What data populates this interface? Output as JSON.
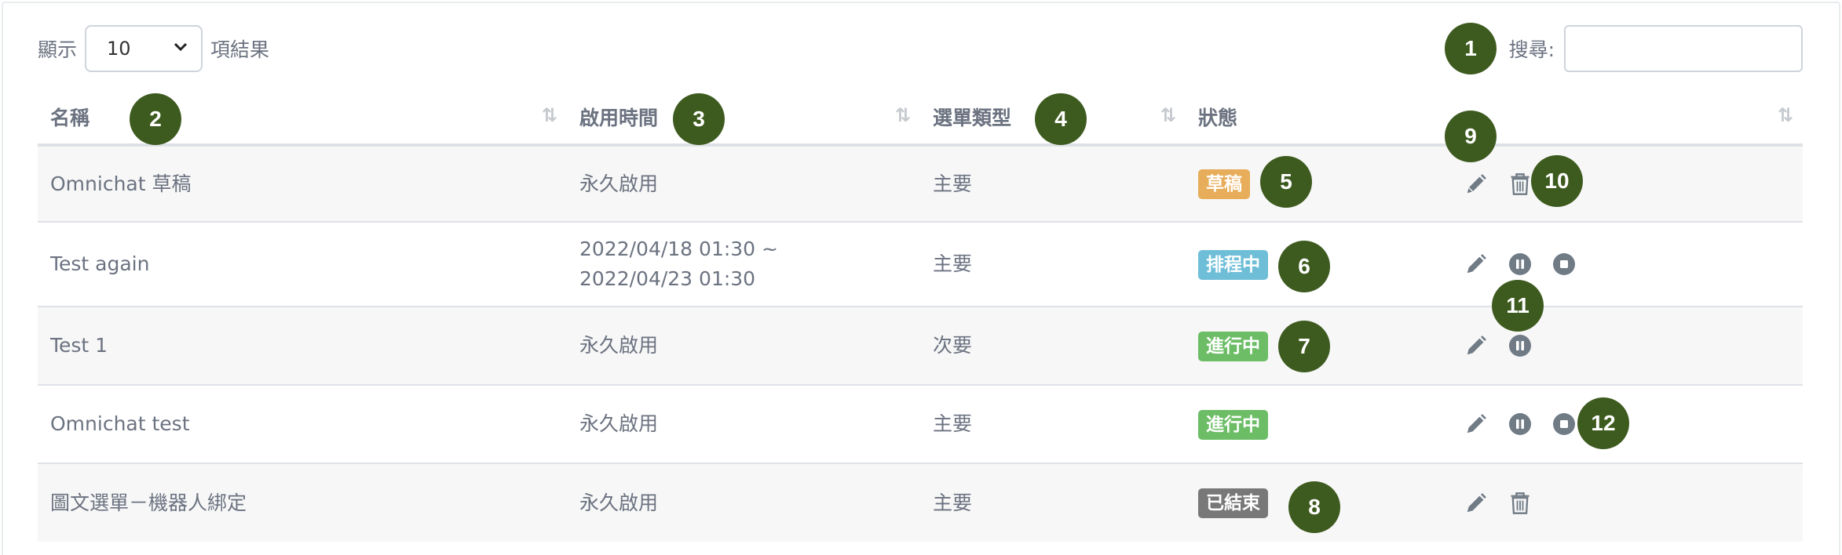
{
  "length_control": {
    "prefix": "顯示",
    "value": "10",
    "suffix": "項結果"
  },
  "search": {
    "label": "搜尋:",
    "value": ""
  },
  "columns": [
    "名稱",
    "啟用時間",
    "選單類型",
    "狀態",
    ""
  ],
  "rows": [
    {
      "name": "Omnichat 草稿",
      "time": "永久啟用",
      "type": "主要",
      "status": "草稿"
    },
    {
      "name": "Test again",
      "time": "2022/04/18 01:30 ~ 2022/04/23 01:30",
      "type": "主要",
      "status": "排程中"
    },
    {
      "name": "Test 1",
      "time": "永久啟用",
      "type": "次要",
      "status": "進行中"
    },
    {
      "name": "Omnichat test",
      "time": "永久啟用",
      "type": "主要",
      "status": "進行中"
    },
    {
      "name": "圖文選單－機器人綁定",
      "time": "永久啟用",
      "type": "主要",
      "status": "已結束"
    }
  ],
  "sort_glyph": "⇅",
  "markers": [
    "1",
    "2",
    "3",
    "4",
    "5",
    "6",
    "7",
    "8",
    "9",
    "10",
    "11",
    "12"
  ],
  "colors": {
    "draft": "#e7ad5a",
    "scheduled": "#6ebed8",
    "active": "#6cbd66",
    "ended": "#787878",
    "action_icon": "#707b86",
    "marker": "#3e5b1f"
  }
}
